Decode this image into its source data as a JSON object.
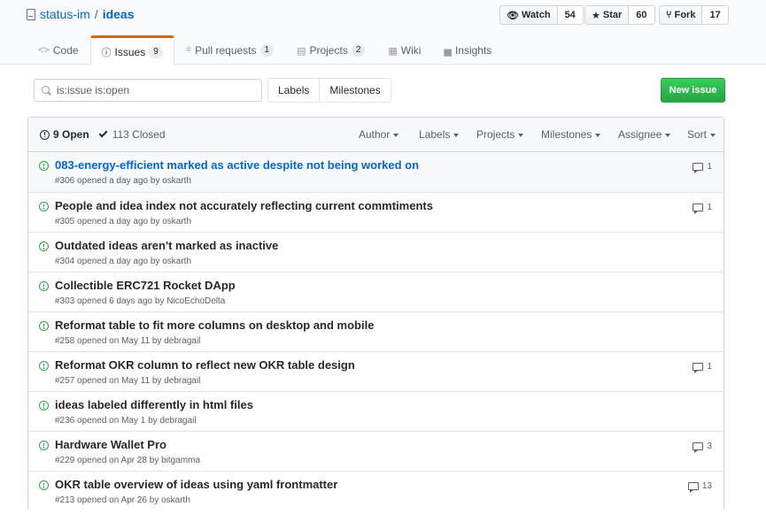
{
  "repo": {
    "owner": "status-im",
    "separator": "/",
    "name": "ideas"
  },
  "actions": {
    "watch": {
      "label": "Watch",
      "count": "54"
    },
    "star": {
      "label": "Star",
      "count": "60"
    },
    "fork": {
      "label": "Fork",
      "count": "17"
    }
  },
  "tabs": [
    {
      "label": "Code",
      "icon": "code-icon",
      "counter": ""
    },
    {
      "label": "Issues",
      "icon": "issue-icon",
      "counter": "9"
    },
    {
      "label": "Pull requests",
      "icon": "pull-request-icon",
      "counter": "1"
    },
    {
      "label": "Projects",
      "icon": "project-icon",
      "counter": "2"
    },
    {
      "label": "Wiki",
      "icon": "book-icon",
      "counter": ""
    },
    {
      "label": "Insights",
      "icon": "graph-icon",
      "counter": ""
    }
  ],
  "search": {
    "value": "is:issue is:open"
  },
  "subnav": {
    "labels": "Labels",
    "milestones": "Milestones"
  },
  "new_issue": "New issue",
  "states": {
    "open": "9 Open",
    "closed": "113 Closed"
  },
  "filters": [
    "Author",
    "Labels",
    "Projects",
    "Milestones",
    "Assignee",
    "Sort"
  ],
  "issues": [
    {
      "title": "083-energy-efficient marked as active despite not being worked on",
      "meta": "#306 opened a day ago by oskarth",
      "comments": "1"
    },
    {
      "title": "People and idea index not accurately reflecting current commtiments",
      "meta": "#305 opened a day ago by oskarth",
      "comments": "1"
    },
    {
      "title": "Outdated ideas aren't marked as inactive",
      "meta": "#304 opened a day ago by oskarth",
      "comments": ""
    },
    {
      "title": "Collectible ERC721 Rocket DApp",
      "meta": "#303 opened 6 days ago by NicoEchoDelta",
      "comments": ""
    },
    {
      "title": "Reformat table to fit more columns on desktop and mobile",
      "meta": "#258 opened on May 11 by debragail",
      "comments": ""
    },
    {
      "title": "Reformat OKR column to reflect new OKR table design",
      "meta": "#257 opened on May 11 by debragail",
      "comments": "1"
    },
    {
      "title": "ideas labeled differently in html files",
      "meta": "#236 opened on May 1 by debragail",
      "comments": ""
    },
    {
      "title": "Hardware Wallet Pro",
      "meta": "#229 opened on Apr 28 by bitgamma",
      "comments": "3"
    },
    {
      "title": "OKR table overview of ideas using yaml frontmatter",
      "meta": "#213 opened on Apr 26 by oskarth",
      "comments": "13"
    }
  ],
  "colors": {
    "accent": "#0366d6",
    "open": "#28a745",
    "tab_highlight": "#e36209"
  }
}
